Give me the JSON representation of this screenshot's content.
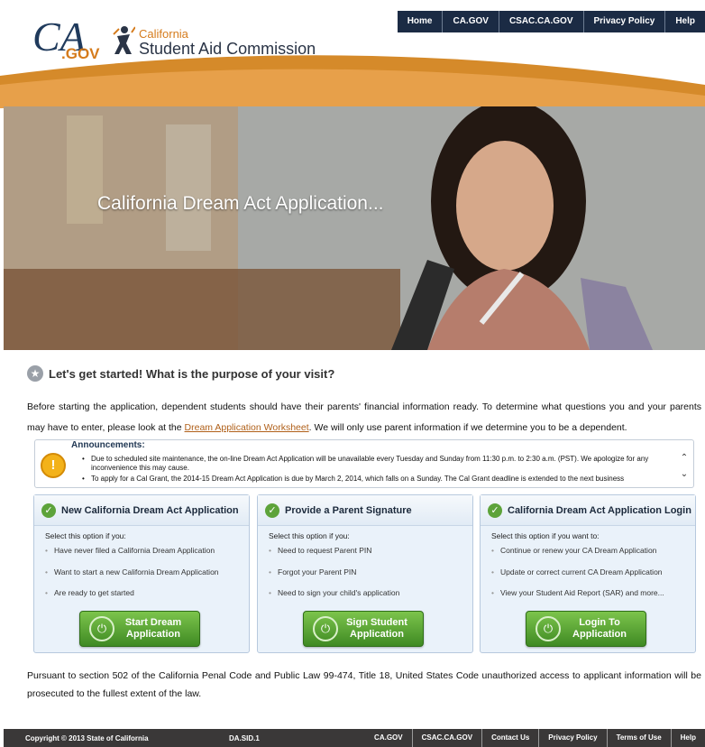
{
  "header": {
    "cagov_logo_text": "CA",
    "cagov_logo_suffix": ".GOV",
    "csac_line1": "California",
    "csac_line2": "Student Aid Commission",
    "nav": [
      "Home",
      "CA.GOV",
      "CSAC.CA.GOV",
      "Privacy Policy",
      "Help"
    ]
  },
  "hero": {
    "title": "California Dream Act Application..."
  },
  "intro": {
    "heading": "Let's get started! What is the purpose of your visit?",
    "text_before": "Before starting the application, dependent students should have their parents' financial information ready. To determine what questions you and your parents may have to enter, please look at the ",
    "link": "Dream Application Worksheet",
    "text_after": ". We will only use parent information if we determine you to be a dependent."
  },
  "announcements": {
    "title": "Announcements:",
    "items": [
      "Due to scheduled site maintenance, the on-line Dream Act Application will be unavailable every Tuesday and Sunday from 11:30 p.m. to 2:30 a.m. (PST). We apologize for any inconvenience this may cause.",
      "To apply for a Cal Grant, the 2014-15 Dream Act Application is due by March 2, 2014, which falls on a Sunday. The Cal Grant deadline is extended to the next business"
    ]
  },
  "cards": [
    {
      "title": "New California Dream Act Application",
      "subtitle": "Select this option if you:",
      "items": [
        "Have never filed a California Dream Application",
        "Want to start a new California Dream Application",
        "Are ready to get started"
      ],
      "button_line1": "Start Dream",
      "button_line2": "Application"
    },
    {
      "title": "Provide a Parent Signature",
      "subtitle": "Select this option if you:",
      "items": [
        "Need to request Parent PIN",
        "Forgot your Parent PIN",
        "Need to sign your child's application"
      ],
      "button_line1": "Sign Student",
      "button_line2": "Application"
    },
    {
      "title": "California Dream Act Application Login",
      "subtitle": "Select this option if you want to:",
      "items": [
        "Continue or renew your CA Dream Application",
        "Update or correct current CA Dream Application",
        "View your Student Aid Report (SAR) and more..."
      ],
      "button_line1": "Login To",
      "button_line2": "Application"
    }
  ],
  "legal": "Pursuant to section 502 of the California Penal Code and Public Law 99-474, Title 18, United States Code unauthorized access to applicant information will be prosecuted to the fullest extent of the law.",
  "footer": {
    "copyright": "Copyright © 2013 State of California",
    "doc_id": "DA.SID.1",
    "nav": [
      "CA.GOV",
      "CSAC.CA.GOV",
      "Contact Us",
      "Privacy Policy",
      "Terms of Use",
      "Help"
    ]
  },
  "colors": {
    "nav_bg": "#1b2b44",
    "orange": "#d57b1c",
    "button_green": "#4f9a2d",
    "footer_bg": "#3a3838",
    "link": "#b0601a"
  }
}
